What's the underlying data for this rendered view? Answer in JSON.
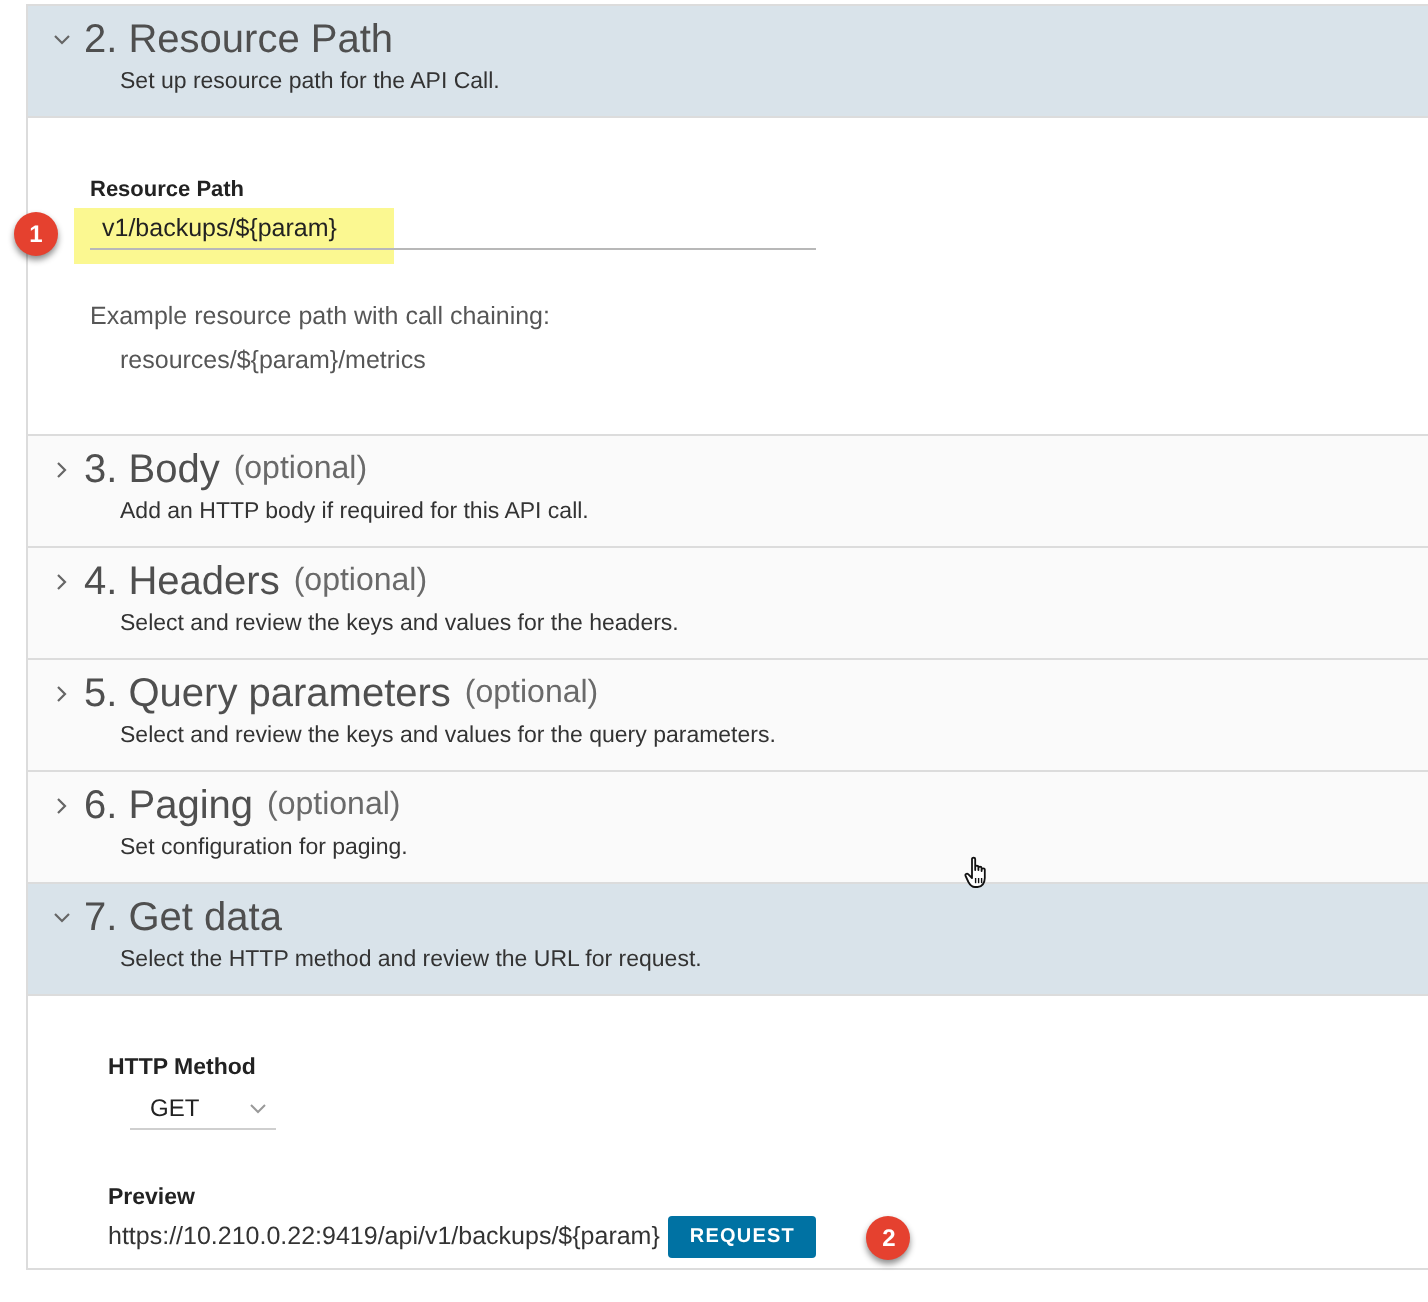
{
  "sections": [
    {
      "title": "2. Resource Path",
      "description": "Set up resource path for the API Call.",
      "expanded": true,
      "kind": "resource_path",
      "field": {
        "label": "Resource Path",
        "value": "v1/backups/${param}",
        "highlighted": true,
        "callout": "1"
      },
      "hint": "Example resource path with call chaining:",
      "example": "resources/${param}/metrics"
    },
    {
      "title": "3. Body",
      "tag": "(optional)",
      "description": "Add an HTTP body if required for this API call.",
      "expanded": false
    },
    {
      "title": "4. Headers",
      "tag": "(optional)",
      "description": "Select and review the keys and values for the headers.",
      "expanded": false
    },
    {
      "title": "5. Query parameters",
      "tag": "(optional)",
      "description": "Select and review the keys and values for the query parameters.",
      "expanded": false
    },
    {
      "title": "6. Paging",
      "tag": "(optional)",
      "description": "Set configuration for paging.",
      "expanded": false
    },
    {
      "title": "7. Get data",
      "description": "Select the HTTP method and review the URL for request.",
      "expanded": true,
      "kind": "get_data",
      "method": {
        "label": "HTTP Method",
        "value": "GET"
      },
      "preview": {
        "label": "Preview",
        "url": "https://10.210.0.22:9419/api/v1/backups/${param}",
        "button": "REQUEST",
        "callout": "2"
      }
    }
  ]
}
